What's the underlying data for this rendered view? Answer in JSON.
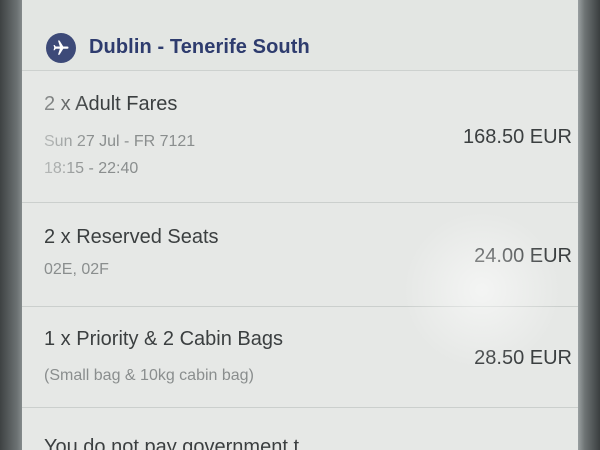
{
  "header": {
    "icon": "plane-icon",
    "route": "Dublin - Tenerife South",
    "accent": "#2e3c6e"
  },
  "items": [
    {
      "title": "2 x Adult Fares",
      "lines": [
        "Sun 27 Jul - FR 7121",
        "18:15 - 22:40"
      ],
      "price": "168.50 EUR"
    },
    {
      "title": "2 x Reserved Seats",
      "lines": [
        "02E, 02F"
      ],
      "price": "24.00 EUR"
    },
    {
      "title": "1 x Priority & 2 Cabin Bags",
      "lines": [
        "(Small bag & 10kg cabin bag)"
      ],
      "price": "28.50 EUR"
    }
  ],
  "footer": {
    "text": "You do not pay government t"
  }
}
